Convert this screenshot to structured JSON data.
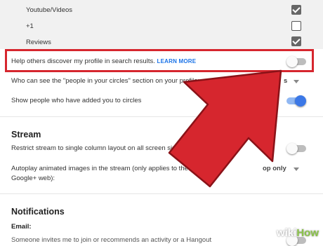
{
  "top_list": {
    "items": [
      {
        "label": "Youtube/Videos",
        "checked": true
      },
      {
        "label": "+1",
        "checked": false
      },
      {
        "label": "Reviews",
        "checked": true
      }
    ]
  },
  "search_discover": {
    "label": "Help others discover my profile in search results.",
    "link": "LEARN MORE",
    "enabled": false
  },
  "circles_section": {
    "label": "Who can see the \"people in your circles\" section on your profile:",
    "value_fragment": "Yo",
    "value_suffix": "s"
  },
  "show_people": {
    "label": "Show people who have added you to circles",
    "enabled": true
  },
  "stream": {
    "heading": "Stream",
    "single_column_label": "Restrict stream to single column layout on all screen sizes",
    "single_column_enabled": false,
    "autoplay_label_line1": "Autoplay animated images in the stream (only applies to the",
    "autoplay_label_line2": "Google+ web):",
    "autoplay_value": "op only"
  },
  "notifications": {
    "heading": "Notifications",
    "email_label": "Email:",
    "cut_text": "Someone invites me to join or recommends an activity or a Hangout",
    "cut_enabled": false
  },
  "watermark": {
    "wiki": "wiki",
    "how": "How"
  },
  "colors": {
    "highlight": "#d6262e",
    "arrow": "#d6262e",
    "link": "#1a73e8",
    "toggle_on": "#3b78e7"
  }
}
